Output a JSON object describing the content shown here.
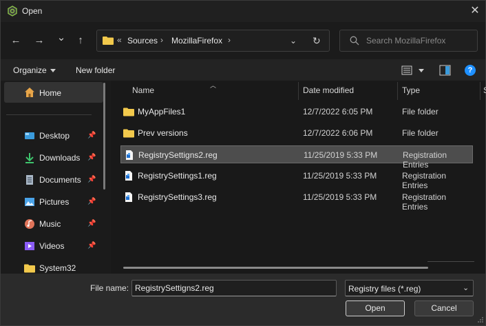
{
  "window": {
    "title": "Open",
    "close_glyph": "✕"
  },
  "icons": {
    "app": "app-logo-icon",
    "close": "close-icon",
    "back": "back-arrow-icon",
    "forward": "forward-arrow-icon",
    "recent": "chevron-down-icon",
    "up": "up-arrow-icon",
    "folder": "folder-icon",
    "refresh": "refresh-icon",
    "search": "search-icon",
    "view": "view-list-icon",
    "pane": "preview-pane-icon",
    "help": "help-icon",
    "pin": "pin-icon",
    "reg": "registry-file-icon"
  },
  "nav": {
    "back_glyph": "←",
    "forward_glyph": "→",
    "recent_glyph": "⌄",
    "up_glyph": "↑",
    "breadcrumb_prefix": "«",
    "breadcrumb": [
      "Sources",
      "MozillaFirefox"
    ],
    "sep_glyph": "›",
    "dropdown_glyph": "⌄",
    "refresh_glyph": "↻",
    "search_placeholder": "Search MozillaFirefox"
  },
  "commands": {
    "organize": "Organize",
    "new_folder": "New folder",
    "help_glyph": "?"
  },
  "sidebar": {
    "home": "Home",
    "items": [
      {
        "label": "Desktop",
        "pinned": true,
        "color": "#3a9bdc"
      },
      {
        "label": "Downloads",
        "pinned": true,
        "color": "#3ec46d"
      },
      {
        "label": "Documents",
        "pinned": true,
        "color": "#a9b7c6"
      },
      {
        "label": "Pictures",
        "pinned": true,
        "color": "#4aa3e8"
      },
      {
        "label": "Music",
        "pinned": true,
        "color": "#e0745a"
      },
      {
        "label": "Videos",
        "pinned": true,
        "color": "#8b5cf6"
      },
      {
        "label": "System32",
        "pinned": false,
        "color": "#f0c04a"
      }
    ]
  },
  "columns": {
    "name": "Name",
    "date": "Date modified",
    "type": "Type",
    "overflow": "S"
  },
  "files": [
    {
      "name": "MyAppFiles1",
      "date": "12/7/2022 6:05 PM",
      "type": "File folder",
      "kind": "folder",
      "selected": false
    },
    {
      "name": "Prev versions",
      "date": "12/7/2022 6:06 PM",
      "type": "File folder",
      "kind": "folder",
      "selected": false
    },
    {
      "name": "RegistrySettigns2.reg",
      "date": "11/25/2019 5:33 PM",
      "type": "Registration Entries",
      "kind": "reg",
      "selected": true
    },
    {
      "name": "RegistrySettings1.reg",
      "date": "11/25/2019 5:33 PM",
      "type": "Registration Entries",
      "kind": "reg",
      "selected": false
    },
    {
      "name": "RegistrySettings3.reg",
      "date": "11/25/2019 5:33 PM",
      "type": "Registration Entries",
      "kind": "reg",
      "selected": false
    }
  ],
  "footer": {
    "filename_label": "File name:",
    "filename_value": "RegistrySettigns2.reg",
    "filetype": "Registry files (*.reg)",
    "chevron_glyph": "⌄",
    "open": "Open",
    "cancel": "Cancel"
  },
  "colors": {
    "folder": "#f2c94c",
    "accent": "#1e90ff",
    "selected_row": "#4d4d4d"
  }
}
